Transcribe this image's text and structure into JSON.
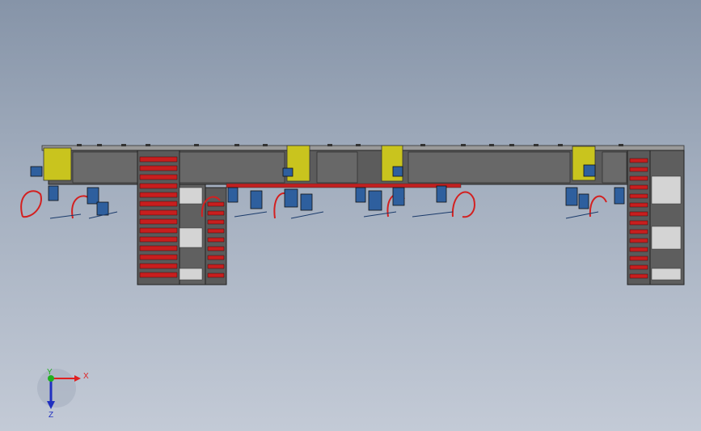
{
  "viewport": {
    "background_top": "#8694a8",
    "background_bottom": "#c3cad6"
  },
  "model": {
    "frame_color": "#5c5c5c",
    "yellow_plate_color": "#c9c41e",
    "red_cable_color": "#d32020",
    "blue_part_color": "#2e5f9e",
    "stack_slot_color": "#c81e1e",
    "light_panel_color": "#d4d4d4"
  },
  "triad": {
    "x_label": "X",
    "y_label": "Y",
    "z_label": "Z",
    "x_color": "#e02020",
    "y_color": "#20b020",
    "z_color": "#2030c0"
  }
}
